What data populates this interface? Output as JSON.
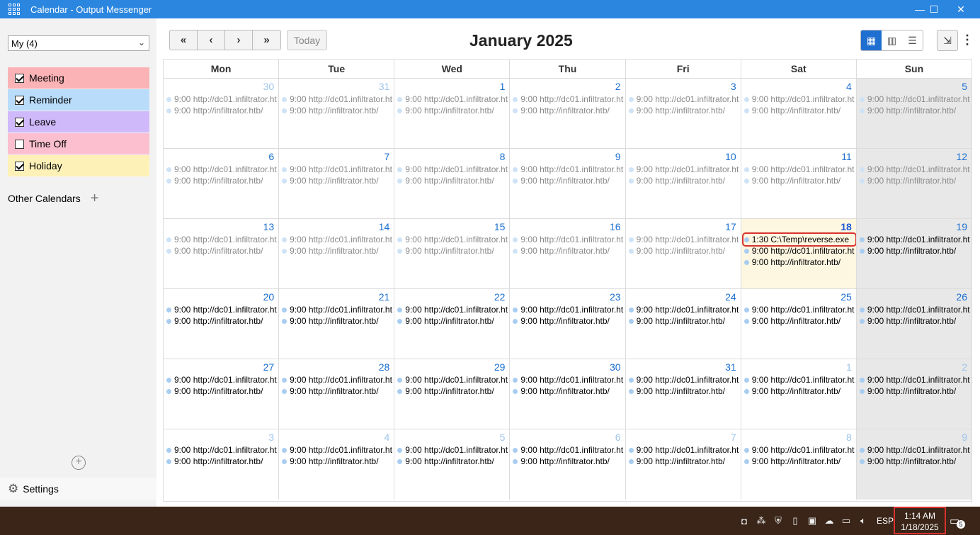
{
  "window": {
    "title": "Calendar - Output Messenger"
  },
  "sidebar": {
    "selector": "My (4)",
    "calendars": [
      {
        "label": "Meeting",
        "checked": true,
        "color": "#fbb3b6"
      },
      {
        "label": "Reminder",
        "checked": true,
        "color": "#b9dcfb"
      },
      {
        "label": "Leave",
        "checked": true,
        "color": "#d0b9fb"
      },
      {
        "label": "Time Off",
        "checked": false,
        "color": "#fbbfcf"
      },
      {
        "label": "Holiday",
        "checked": true,
        "color": "#fdf1b8"
      }
    ],
    "other_calendars": "Other Calendars",
    "settings": "Settings"
  },
  "toolbar": {
    "first": "«",
    "prev": "‹",
    "next": "›",
    "last": "»",
    "today": "Today",
    "month_title": "January 2025"
  },
  "weekdays": [
    "Mon",
    "Tue",
    "Wed",
    "Thu",
    "Fri",
    "Sat",
    "Sun"
  ],
  "weeks": [
    [
      {
        "day": "30",
        "other": true,
        "events": [
          {
            "text": "9:00 http://dc01.infiltrator.ht",
            "state": "past"
          },
          {
            "text": "9:00 http://infiltrator.htb/",
            "state": "past"
          }
        ]
      },
      {
        "day": "31",
        "other": true,
        "events": [
          {
            "text": "9:00 http://dc01.infiltrator.ht",
            "state": "past"
          },
          {
            "text": "9:00 http://infiltrator.htb/",
            "state": "past"
          }
        ]
      },
      {
        "day": "1",
        "events": [
          {
            "text": "9:00 http://dc01.infiltrator.ht",
            "state": "past"
          },
          {
            "text": "9:00 http://infiltrator.htb/",
            "state": "past"
          }
        ]
      },
      {
        "day": "2",
        "events": [
          {
            "text": "9:00 http://dc01.infiltrator.ht",
            "state": "past"
          },
          {
            "text": "9:00 http://infiltrator.htb/",
            "state": "past"
          }
        ]
      },
      {
        "day": "3",
        "events": [
          {
            "text": "9:00 http://dc01.infiltrator.ht",
            "state": "past"
          },
          {
            "text": "9:00 http://infiltrator.htb/",
            "state": "past"
          }
        ]
      },
      {
        "day": "4",
        "events": [
          {
            "text": "9:00 http://dc01.infiltrator.ht",
            "state": "past"
          },
          {
            "text": "9:00 http://infiltrator.htb/",
            "state": "past"
          }
        ]
      },
      {
        "day": "5",
        "events": [
          {
            "text": "9:00 http://dc01.infiltrator.ht",
            "state": "past"
          },
          {
            "text": "9:00 http://infiltrator.htb/",
            "state": "past"
          }
        ]
      }
    ],
    [
      {
        "day": "6",
        "events": [
          {
            "text": "9:00 http://dc01.infiltrator.ht",
            "state": "past"
          },
          {
            "text": "9:00 http://infiltrator.htb/",
            "state": "past"
          }
        ]
      },
      {
        "day": "7",
        "events": [
          {
            "text": "9:00 http://dc01.infiltrator.ht",
            "state": "past"
          },
          {
            "text": "9:00 http://infiltrator.htb/",
            "state": "past"
          }
        ]
      },
      {
        "day": "8",
        "events": [
          {
            "text": "9:00 http://dc01.infiltrator.ht",
            "state": "past"
          },
          {
            "text": "9:00 http://infiltrator.htb/",
            "state": "past"
          }
        ]
      },
      {
        "day": "9",
        "events": [
          {
            "text": "9:00 http://dc01.infiltrator.ht",
            "state": "past"
          },
          {
            "text": "9:00 http://infiltrator.htb/",
            "state": "past"
          }
        ]
      },
      {
        "day": "10",
        "events": [
          {
            "text": "9:00 http://dc01.infiltrator.ht",
            "state": "past"
          },
          {
            "text": "9:00 http://infiltrator.htb/",
            "state": "past"
          }
        ]
      },
      {
        "day": "11",
        "events": [
          {
            "text": "9:00 http://dc01.infiltrator.ht",
            "state": "past"
          },
          {
            "text": "9:00 http://infiltrator.htb/",
            "state": "past"
          }
        ]
      },
      {
        "day": "12",
        "events": [
          {
            "text": "9:00 http://dc01.infiltrator.ht",
            "state": "past"
          },
          {
            "text": "9:00 http://infiltrator.htb/",
            "state": "past"
          }
        ]
      }
    ],
    [
      {
        "day": "13",
        "events": [
          {
            "text": "9:00 http://dc01.infiltrator.ht",
            "state": "past"
          },
          {
            "text": "9:00 http://infiltrator.htb/",
            "state": "past"
          }
        ]
      },
      {
        "day": "14",
        "events": [
          {
            "text": "9:00 http://dc01.infiltrator.ht",
            "state": "past"
          },
          {
            "text": "9:00 http://infiltrator.htb/",
            "state": "past"
          }
        ]
      },
      {
        "day": "15",
        "events": [
          {
            "text": "9:00 http://dc01.infiltrator.ht",
            "state": "past"
          },
          {
            "text": "9:00 http://infiltrator.htb/",
            "state": "past"
          }
        ]
      },
      {
        "day": "16",
        "events": [
          {
            "text": "9:00 http://dc01.infiltrator.ht",
            "state": "past"
          },
          {
            "text": "9:00 http://infiltrator.htb/",
            "state": "past"
          }
        ]
      },
      {
        "day": "17",
        "events": [
          {
            "text": "9:00 http://dc01.infiltrator.ht",
            "state": "past"
          },
          {
            "text": "9:00 http://infiltrator.htb/",
            "state": "past"
          }
        ]
      },
      {
        "day": "18",
        "today": true,
        "events": [
          {
            "text": "1:30 C:\\Temp\\reverse.exe",
            "state": "cur",
            "highlight": true
          },
          {
            "text": "9:00 http://dc01.infiltrator.ht",
            "state": "cur"
          },
          {
            "text": "9:00 http://infiltrator.htb/",
            "state": "cur"
          }
        ]
      },
      {
        "day": "19",
        "events": [
          {
            "text": "9:00 http://dc01.infiltrator.ht",
            "state": "cur"
          },
          {
            "text": "9:00 http://infiltrator.htb/",
            "state": "cur"
          }
        ]
      }
    ],
    [
      {
        "day": "20",
        "events": [
          {
            "text": "9:00 http://dc01.infiltrator.ht",
            "state": "cur"
          },
          {
            "text": "9:00 http://infiltrator.htb/",
            "state": "cur"
          }
        ]
      },
      {
        "day": "21",
        "events": [
          {
            "text": "9:00 http://dc01.infiltrator.ht",
            "state": "cur"
          },
          {
            "text": "9:00 http://infiltrator.htb/",
            "state": "cur"
          }
        ]
      },
      {
        "day": "22",
        "events": [
          {
            "text": "9:00 http://dc01.infiltrator.ht",
            "state": "cur"
          },
          {
            "text": "9:00 http://infiltrator.htb/",
            "state": "cur"
          }
        ]
      },
      {
        "day": "23",
        "events": [
          {
            "text": "9:00 http://dc01.infiltrator.ht",
            "state": "cur"
          },
          {
            "text": "9:00 http://infiltrator.htb/",
            "state": "cur"
          }
        ]
      },
      {
        "day": "24",
        "events": [
          {
            "text": "9:00 http://dc01.infiltrator.ht",
            "state": "cur"
          },
          {
            "text": "9:00 http://infiltrator.htb/",
            "state": "cur"
          }
        ]
      },
      {
        "day": "25",
        "events": [
          {
            "text": "9:00 http://dc01.infiltrator.ht",
            "state": "cur"
          },
          {
            "text": "9:00 http://infiltrator.htb/",
            "state": "cur"
          }
        ]
      },
      {
        "day": "26",
        "events": [
          {
            "text": "9:00 http://dc01.infiltrator.ht",
            "state": "cur"
          },
          {
            "text": "9:00 http://infiltrator.htb/",
            "state": "cur"
          }
        ]
      }
    ],
    [
      {
        "day": "27",
        "events": [
          {
            "text": "9:00 http://dc01.infiltrator.ht",
            "state": "cur"
          },
          {
            "text": "9:00 http://infiltrator.htb/",
            "state": "cur"
          }
        ]
      },
      {
        "day": "28",
        "events": [
          {
            "text": "9:00 http://dc01.infiltrator.ht",
            "state": "cur"
          },
          {
            "text": "9:00 http://infiltrator.htb/",
            "state": "cur"
          }
        ]
      },
      {
        "day": "29",
        "events": [
          {
            "text": "9:00 http://dc01.infiltrator.ht",
            "state": "cur"
          },
          {
            "text": "9:00 http://infiltrator.htb/",
            "state": "cur"
          }
        ]
      },
      {
        "day": "30",
        "events": [
          {
            "text": "9:00 http://dc01.infiltrator.ht",
            "state": "cur"
          },
          {
            "text": "9:00 http://infiltrator.htb/",
            "state": "cur"
          }
        ]
      },
      {
        "day": "31",
        "events": [
          {
            "text": "9:00 http://dc01.infiltrator.ht",
            "state": "cur"
          },
          {
            "text": "9:00 http://infiltrator.htb/",
            "state": "cur"
          }
        ]
      },
      {
        "day": "1",
        "other": true,
        "events": [
          {
            "text": "9:00 http://dc01.infiltrator.ht",
            "state": "cur"
          },
          {
            "text": "9:00 http://infiltrator.htb/",
            "state": "cur"
          }
        ]
      },
      {
        "day": "2",
        "other": true,
        "events": [
          {
            "text": "9:00 http://dc01.infiltrator.ht",
            "state": "cur"
          },
          {
            "text": "9:00 http://infiltrator.htb/",
            "state": "cur"
          }
        ]
      }
    ],
    [
      {
        "day": "3",
        "other": true,
        "events": [
          {
            "text": "9:00 http://dc01.infiltrator.ht",
            "state": "cur"
          },
          {
            "text": "9:00 http://infiltrator.htb/",
            "state": "cur"
          }
        ]
      },
      {
        "day": "4",
        "other": true,
        "events": [
          {
            "text": "9:00 http://dc01.infiltrator.ht",
            "state": "cur"
          },
          {
            "text": "9:00 http://infiltrator.htb/",
            "state": "cur"
          }
        ]
      },
      {
        "day": "5",
        "other": true,
        "events": [
          {
            "text": "9:00 http://dc01.infiltrator.ht",
            "state": "cur"
          },
          {
            "text": "9:00 http://infiltrator.htb/",
            "state": "cur"
          }
        ]
      },
      {
        "day": "6",
        "other": true,
        "events": [
          {
            "text": "9:00 http://dc01.infiltrator.ht",
            "state": "cur"
          },
          {
            "text": "9:00 http://infiltrator.htb/",
            "state": "cur"
          }
        ]
      },
      {
        "day": "7",
        "other": true,
        "events": [
          {
            "text": "9:00 http://dc01.infiltrator.ht",
            "state": "cur"
          },
          {
            "text": "9:00 http://infiltrator.htb/",
            "state": "cur"
          }
        ]
      },
      {
        "day": "8",
        "other": true,
        "events": [
          {
            "text": "9:00 http://dc01.infiltrator.ht",
            "state": "cur"
          },
          {
            "text": "9:00 http://infiltrator.htb/",
            "state": "cur"
          }
        ]
      },
      {
        "day": "9",
        "other": true,
        "events": [
          {
            "text": "9:00 http://dc01.infiltrator.ht",
            "state": "cur"
          },
          {
            "text": "9:00 http://infiltrator.htb/",
            "state": "cur"
          }
        ]
      }
    ]
  ],
  "taskbar": {
    "language": "ESP",
    "time": "1:14 AM",
    "date": "1/18/2025",
    "notification_count": "5"
  }
}
